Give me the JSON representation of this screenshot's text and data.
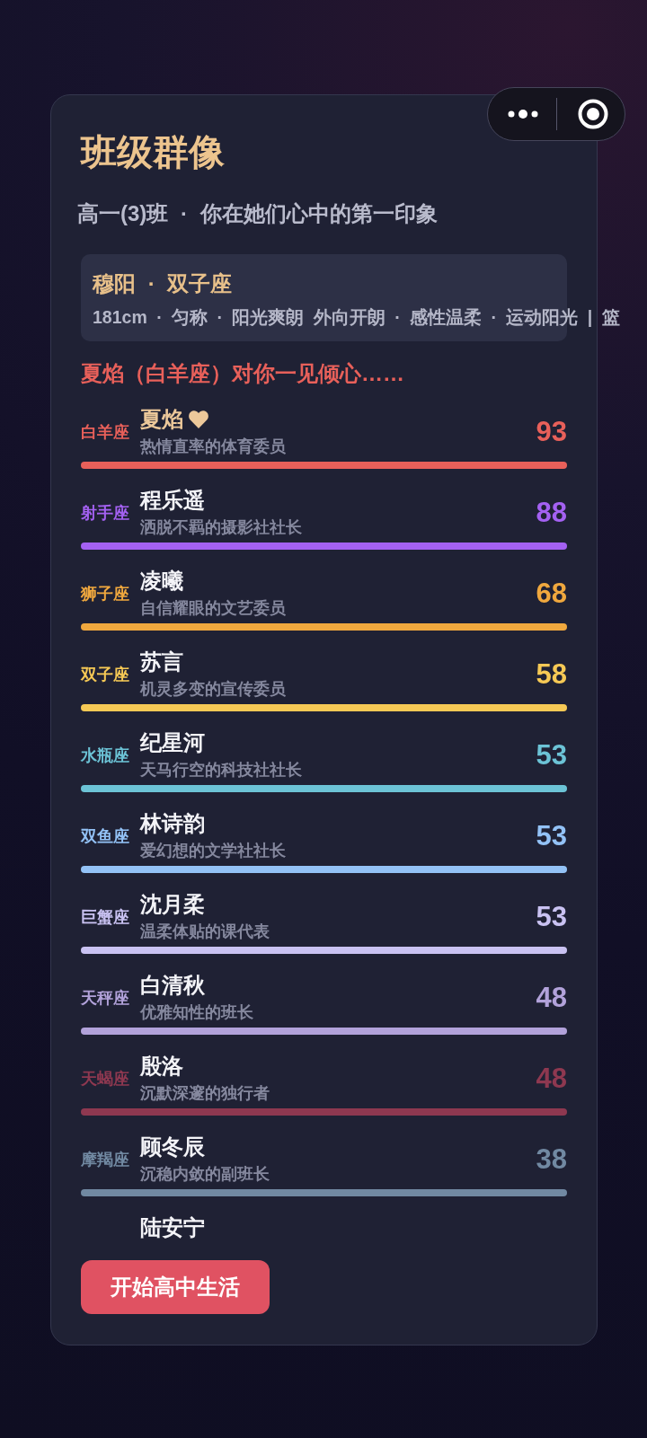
{
  "title": "班级群像",
  "subtitle": "高一(3)班 · 你在她们心中的第一印象",
  "profile": {
    "name_line": "穆阳 · 双子座",
    "tags": "181cm · 匀称 · 阳光爽朗 外向开朗 · 感性温柔 · 运动阳光 | 篮"
  },
  "headline": "夏焰（白羊座）对你一见倾心……",
  "classmates": [
    {
      "kind": "row",
      "constellation": "白羊座",
      "name": "夏焰",
      "crush": true,
      "description": "热情直率的体育委员",
      "score": "93",
      "color": "#e8605a"
    },
    {
      "kind": "row",
      "constellation": "射手座",
      "name": "程乐遥",
      "crush": false,
      "description": "洒脱不羁的摄影社社长",
      "score": "88",
      "color": "#a461f2"
    },
    {
      "kind": "row",
      "constellation": "狮子座",
      "name": "凌曦",
      "crush": false,
      "description": "自信耀眼的文艺委员",
      "score": "68",
      "color": "#f0a83e"
    },
    {
      "kind": "row",
      "constellation": "双子座",
      "name": "苏言",
      "crush": false,
      "description": "机灵多变的宣传委员",
      "score": "58",
      "color": "#f6c955"
    },
    {
      "kind": "row",
      "constellation": "水瓶座",
      "name": "纪星河",
      "crush": false,
      "description": "天马行空的科技社社长",
      "score": "53",
      "color": "#6cc3d6"
    },
    {
      "kind": "row",
      "constellation": "双鱼座",
      "name": "林诗韵",
      "crush": false,
      "description": "爱幻想的文学社社长",
      "score": "53",
      "color": "#93c2f6"
    },
    {
      "kind": "row",
      "constellation": "巨蟹座",
      "name": "沈月柔",
      "crush": false,
      "description": "温柔体贴的课代表",
      "score": "53",
      "color": "#c9c2f2"
    },
    {
      "kind": "row",
      "constellation": "天秤座",
      "name": "白清秋",
      "crush": false,
      "description": "优雅知性的班长",
      "score": "48",
      "color": "#b2a2da"
    },
    {
      "kind": "row",
      "constellation": "天蝎座",
      "name": "殷洛",
      "crush": false,
      "description": "沉默深邃的独行者",
      "score": "48",
      "color": "#8e3850"
    },
    {
      "kind": "row",
      "constellation": "摩羯座",
      "name": "顾冬辰",
      "crush": false,
      "description": "沉稳内敛的副班长",
      "score": "38",
      "color": "#7189a2"
    },
    {
      "kind": "cut",
      "name": "陆安宁"
    }
  ],
  "button": "开始高中生活"
}
